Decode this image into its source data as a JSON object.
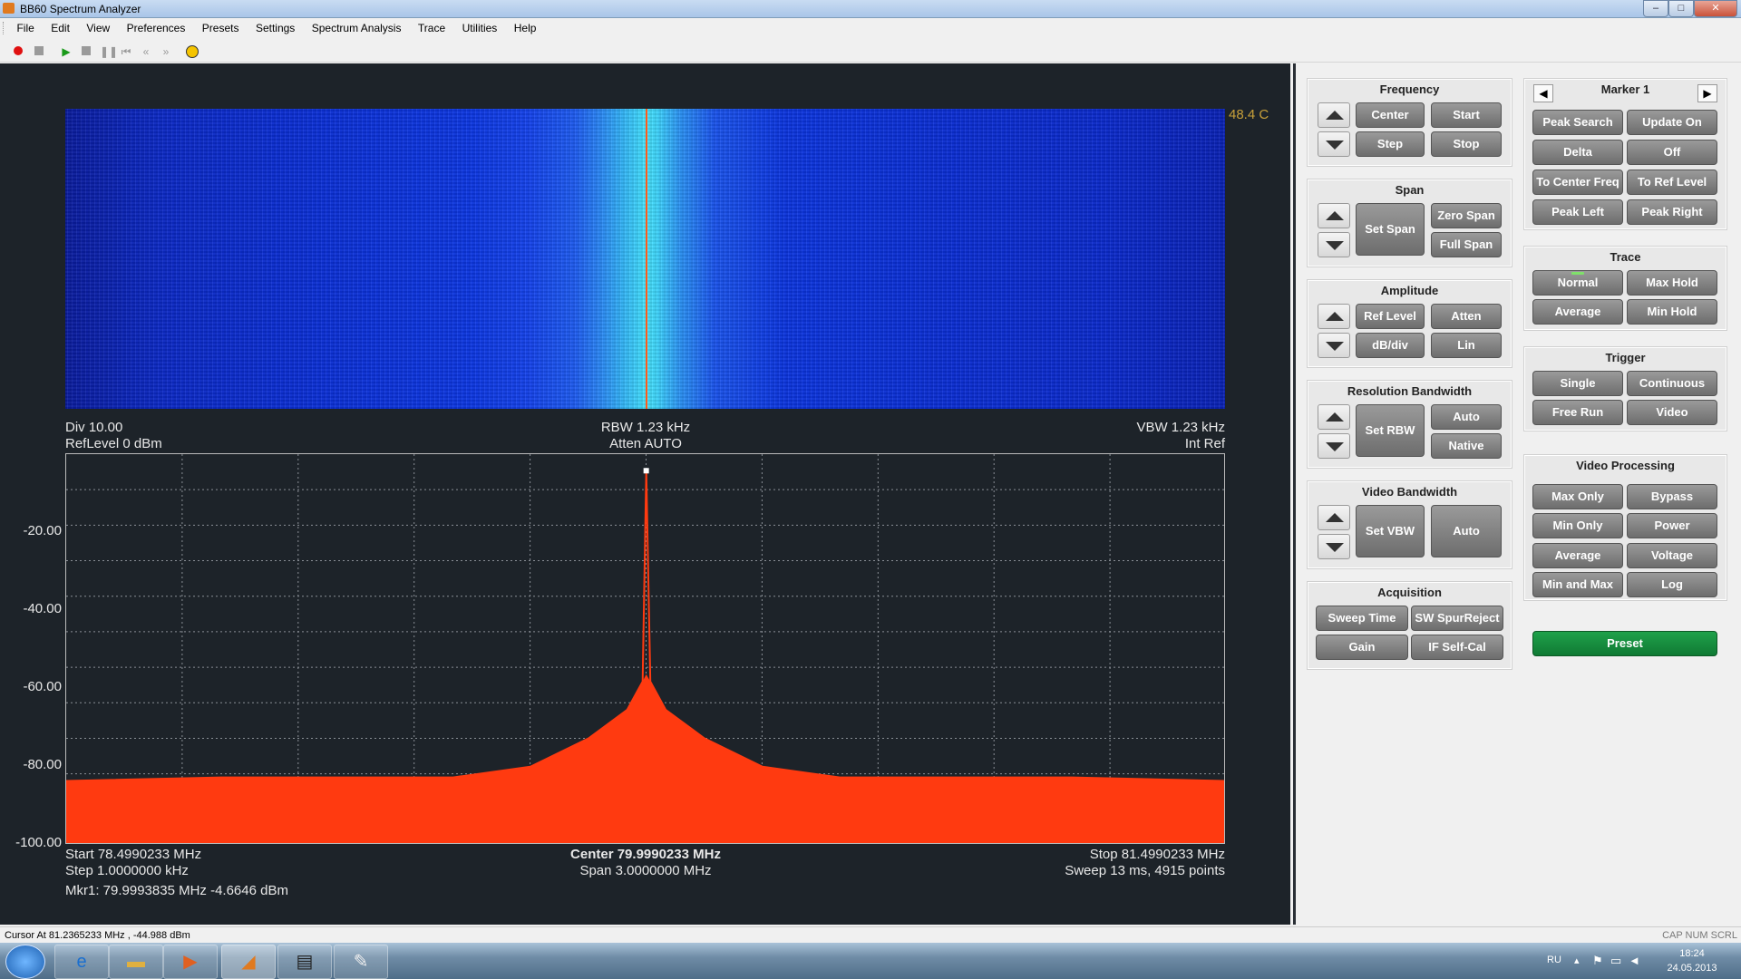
{
  "window": {
    "title": "BB60 Spectrum Analyzer",
    "controls": [
      "–",
      "□",
      "✕"
    ]
  },
  "menu": [
    "File",
    "Edit",
    "View",
    "Preferences",
    "Presets",
    "Settings",
    "Spectrum Analysis",
    "Trace",
    "Utilities",
    "Help"
  ],
  "toolbar": {
    "icons": [
      "record-icon",
      "stop-record-icon",
      "play-icon",
      "stop-icon",
      "pause-icon",
      "skip-start-icon",
      "rewind-icon",
      "fast-forward-icon",
      "settings-circle-icon"
    ]
  },
  "display": {
    "temperature": "48.4 C",
    "div": "Div 10.00",
    "ref_level": "RefLevel 0 dBm",
    "rbw": "RBW 1.23 kHz",
    "atten": "Atten AUTO",
    "vbw": "VBW 1.23 kHz",
    "int_ref": "Int Ref",
    "y_ticks": [
      "-20.00",
      "-40.00",
      "-60.00",
      "-80.00",
      "-100.00"
    ],
    "start": "Start 78.4990233 MHz",
    "center": "Center 79.9990233 MHz",
    "stop": "Stop 81.4990233 MHz",
    "step": "Step 1.0000000 kHz",
    "span": "Span 3.0000000 MHz",
    "sweep": "Sweep 13 ms, 4915 points",
    "marker": "Mkr1: 79.9993835 MHz -4.6646 dBm"
  },
  "chart_data": {
    "type": "line",
    "xlabel": "",
    "ylabel": "",
    "xlim": [
      78.4990233,
      81.4990233
    ],
    "ylim": [
      -110,
      0
    ],
    "series": [
      {
        "x": [
          78.4990233,
          78.9,
          79.5,
          79.7,
          79.85,
          79.95,
          79.99,
          79.9993835,
          80.01,
          80.05,
          80.15,
          80.3,
          80.5,
          81.1,
          81.4990233
        ],
        "values": [
          -92,
          -91,
          -91,
          -88,
          -80,
          -72,
          -64,
          -4.6646,
          -64,
          -72,
          -80,
          -88,
          -91,
          -91,
          -92
        ]
      }
    ],
    "marker": {
      "x": 79.9993835,
      "y": -4.6646
    }
  },
  "panel": {
    "frequency": {
      "title": "Frequency",
      "center": "Center",
      "start": "Start",
      "step": "Step",
      "stop": "Stop"
    },
    "span": {
      "title": "Span",
      "set": "Set Span",
      "zero": "Zero Span",
      "full": "Full Span"
    },
    "amplitude": {
      "title": "Amplitude",
      "ref": "Ref Level",
      "atten": "Atten",
      "dbdiv": "dB/div",
      "lin": "Lin"
    },
    "rbw": {
      "title": "Resolution Bandwidth",
      "set": "Set RBW",
      "auto": "Auto",
      "native": "Native"
    },
    "vbw": {
      "title": "Video Bandwidth",
      "set": "Set VBW",
      "auto": "Auto"
    },
    "acq": {
      "title": "Acquisition",
      "sweep": "Sweep Time",
      "spur": "SW SpurReject",
      "gain": "Gain",
      "ifcal": "IF Self-Cal"
    },
    "marker": {
      "title": "Marker 1",
      "peak_search": "Peak Search",
      "update_on": "Update On",
      "delta": "Delta",
      "off": "Off",
      "to_center": "To Center Freq",
      "to_ref": "To Ref Level",
      "peak_left": "Peak Left",
      "peak_right": "Peak Right"
    },
    "trace": {
      "title": "Trace",
      "normal": "Normal",
      "max_hold": "Max Hold",
      "average": "Average",
      "min_hold": "Min Hold"
    },
    "trigger": {
      "title": "Trigger",
      "single": "Single",
      "continuous": "Continuous",
      "free_run": "Free Run",
      "video": "Video"
    },
    "video_proc": {
      "title": "Video Processing",
      "max_only": "Max Only",
      "bypass": "Bypass",
      "min_only": "Min Only",
      "power": "Power",
      "average": "Average",
      "voltage": "Voltage",
      "min_max": "Min and Max",
      "log": "Log"
    },
    "preset": "Preset"
  },
  "status": {
    "cursor": "Cursor At 81.2365233 MHz , -44.988 dBm",
    "keys": "CAP  NUM  SCRL"
  },
  "taskbar": {
    "lang": "RU",
    "time": "18:24",
    "date": "24.05.2013"
  },
  "colors": {
    "display_bg": "#1d2329",
    "trace": "#ff3a10",
    "preset": "#1a9444"
  }
}
